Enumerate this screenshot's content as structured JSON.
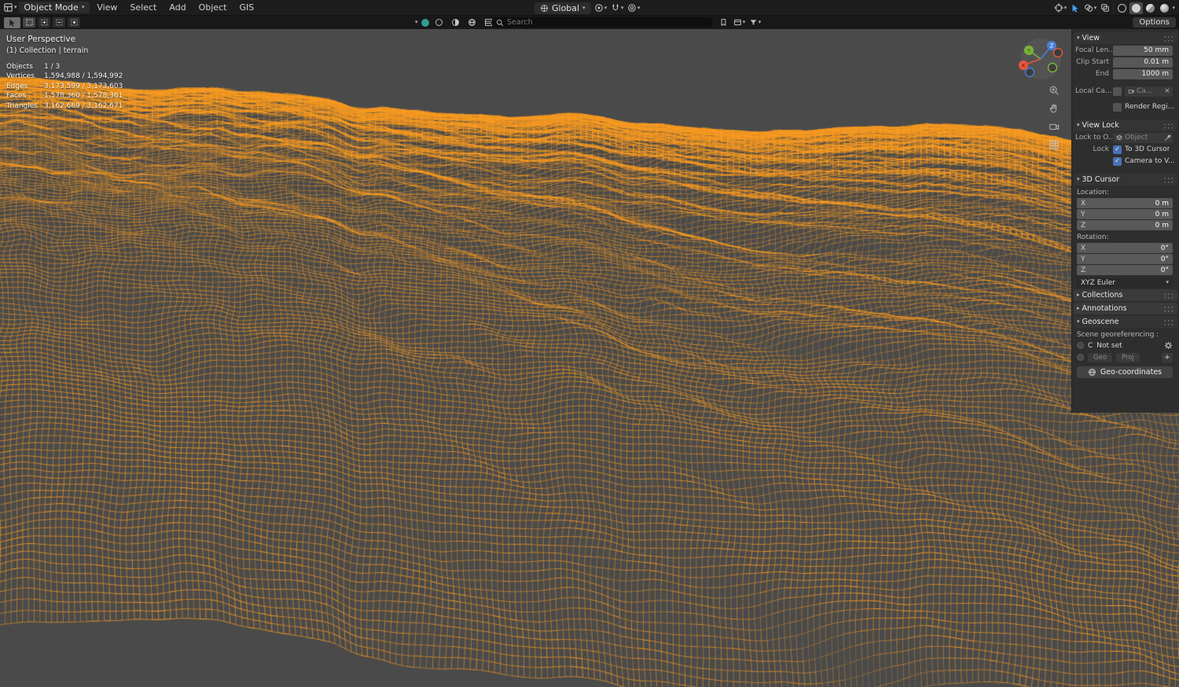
{
  "glyphs": {
    "chevron_down": "▾",
    "chevron_right": "▸",
    "check": "✓",
    "close": "×",
    "plus": "+"
  },
  "topbar": {
    "mode": "Object Mode",
    "menus": [
      "View",
      "Select",
      "Add",
      "Object",
      "GIS"
    ],
    "orientation": "Global"
  },
  "toolbar": {
    "search_placeholder": "Search",
    "options_label": "Options"
  },
  "viewport": {
    "projection_label": "User Perspective",
    "context_label": "(1) Collection | terrain",
    "stats": [
      {
        "label": "Objects",
        "value": "1 / 3"
      },
      {
        "label": "Vertices",
        "value": "1,594,988 / 1,594,992"
      },
      {
        "label": "Edges",
        "value": "3,173,599 / 3,173,603"
      },
      {
        "label": "Faces",
        "value": "1,578,360 / 1,578,361"
      },
      {
        "label": "Triangles",
        "value": "3,162,669 / 3,162,671"
      }
    ],
    "gizmo": {
      "x": "X",
      "y": "Y",
      "z": "Z"
    }
  },
  "sidebar": {
    "view": {
      "title": "View",
      "focal_label": "Focal Len...",
      "focal_value": "50 mm",
      "clip_start_label": "Clip Start",
      "clip_start_value": "0.01 m",
      "clip_end_label": "End",
      "clip_end_value": "1000 m",
      "local_camera_label": "Local Ca...",
      "local_camera_value": "Ca...",
      "render_region_label": "Render Regi..."
    },
    "view_lock": {
      "title": "View Lock",
      "lock_object_label": "Lock to O...",
      "lock_object_value": "Object",
      "lock_label": "Lock",
      "lock_cursor_label": "To 3D Cursor",
      "lock_camera_label": "Camera to V..."
    },
    "cursor3d": {
      "title": "3D Cursor",
      "location_label": "Location:",
      "rotation_label": "Rotation:",
      "loc": [
        {
          "axis": "X",
          "value": "0 m"
        },
        {
          "axis": "Y",
          "value": "0 m"
        },
        {
          "axis": "Z",
          "value": "0 m"
        }
      ],
      "rot": [
        {
          "axis": "X",
          "value": "0°"
        },
        {
          "axis": "Y",
          "value": "0°"
        },
        {
          "axis": "Z",
          "value": "0°"
        }
      ],
      "euler_mode": "XYZ Euler"
    },
    "collections": {
      "title": "Collections"
    },
    "annotations": {
      "title": "Annotations"
    },
    "geoscene": {
      "title": "Geoscene",
      "subtitle": "Scene georeferencing :",
      "crs_prefix": "C",
      "crs_value": "Not set",
      "geo_btn": "Geo",
      "proj_btn": "Proj",
      "add_btn": "+",
      "coords_btn": "Geo-coordinates"
    }
  },
  "colors": {
    "selection_orange": "#fa9b20",
    "viewport_bg": "#4a4a4a",
    "checkbox_blue": "#4772b3",
    "axis_x": "#e8553f",
    "axis_y": "#7bb33a",
    "axis_z": "#4a7fd6"
  }
}
